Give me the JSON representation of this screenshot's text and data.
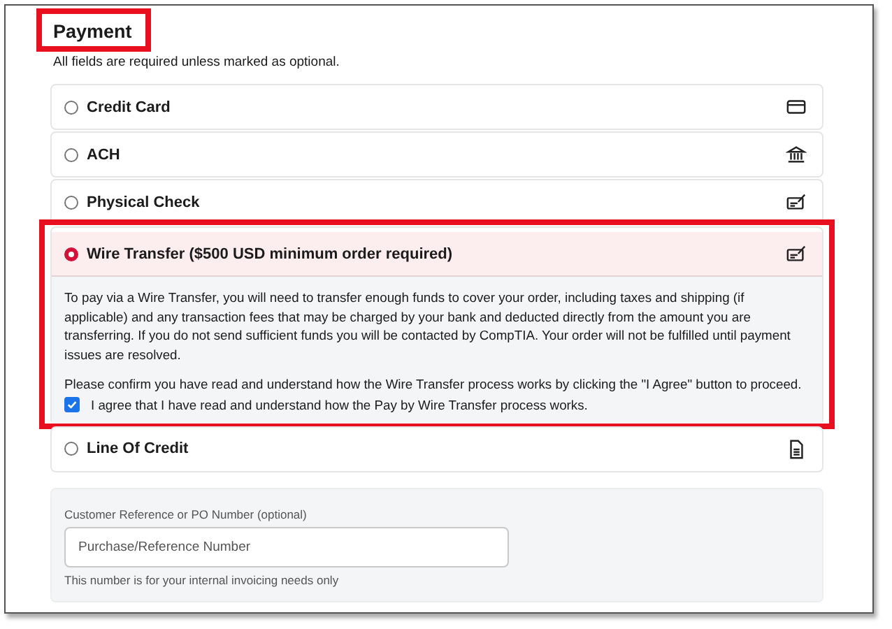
{
  "heading": {
    "text": "Payment",
    "highlighted": true
  },
  "note": "All fields are required unless marked as optional.",
  "options": [
    {
      "label": "Credit Card",
      "kind": "card",
      "selected": false,
      "highlighted": false
    },
    {
      "label": "ACH",
      "kind": "bank",
      "selected": false,
      "highlighted": false
    },
    {
      "label": "Physical Check",
      "kind": "check",
      "selected": false,
      "highlighted": false
    },
    {
      "label": "Wire Transfer ($500 USD minimum order required)",
      "kind": "check",
      "selected": true,
      "highlighted": true,
      "details": [
        "To pay via a Wire Transfer, you will need to transfer enough funds to cover your order, including taxes and shipping (if applicable) and any transaction fees that may be charged by your bank and deducted directly from the amount you are transferring. If you do not send sufficient funds you will be contacted by CompTIA. Your order will not be fulfilled until payment issues are resolved.",
        "Please confirm you have read and understand how the Wire Transfer process works by clicking the \"I Agree\" button to proceed."
      ],
      "agreement": {
        "label": "I agree that I have read and understand how the Pay by Wire Transfer process works.",
        "checked": true
      }
    },
    {
      "label": "Line Of Credit",
      "kind": "document",
      "selected": false,
      "highlighted": false
    }
  ],
  "reference": {
    "label": "Customer Reference or PO Number (optional)",
    "placeholder": "Purchase/Reference Number",
    "help": "This number is for your internal invoicing needs only"
  }
}
